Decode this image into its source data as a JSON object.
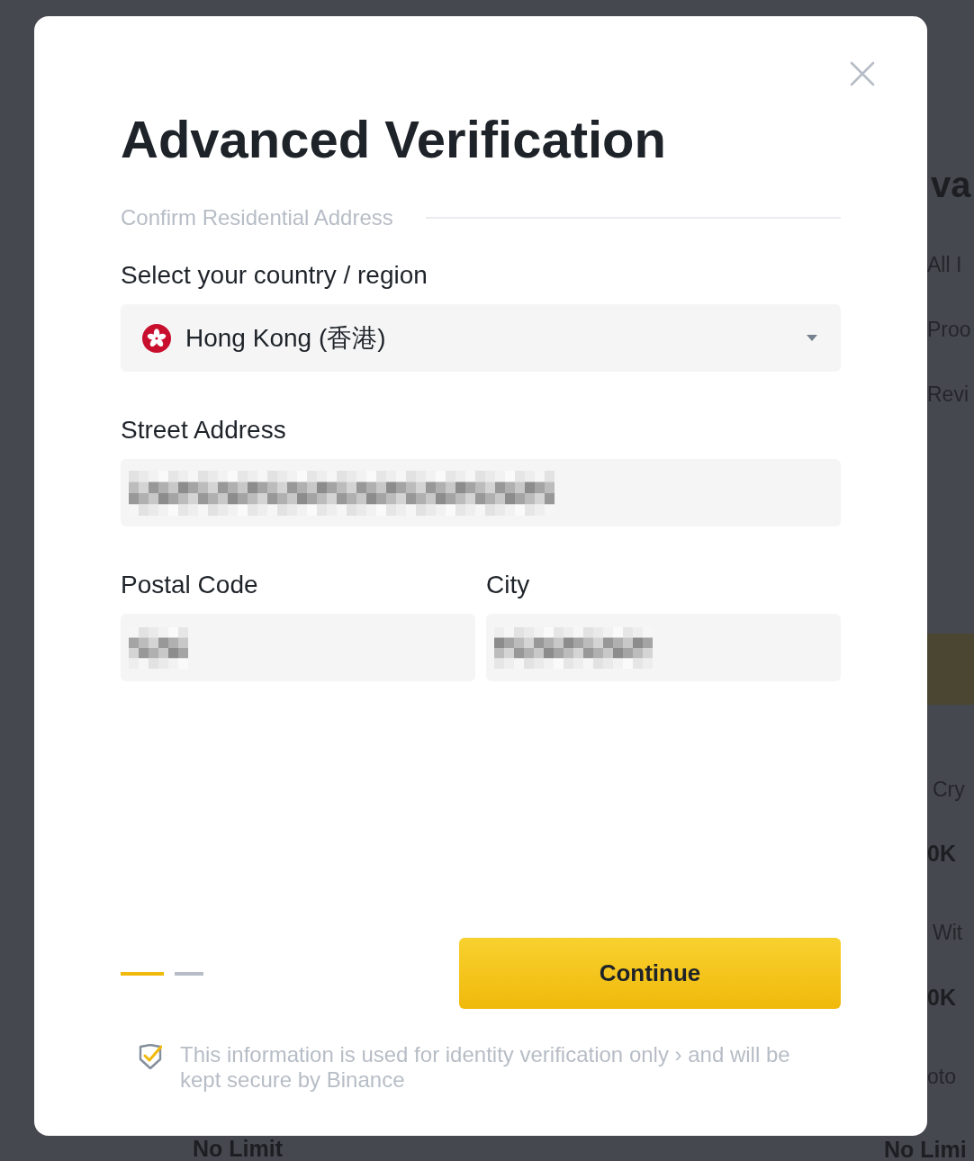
{
  "background_page": {
    "side_items": [
      {
        "kind": "title",
        "text": "va"
      },
      {
        "kind": "label",
        "text": "All I"
      },
      {
        "kind": "label",
        "text": "Proo"
      },
      {
        "kind": "label",
        "text": "Revi"
      },
      {
        "kind": "banner"
      },
      {
        "kind": "label",
        "text": "Cry"
      },
      {
        "kind": "value",
        "text": "0K"
      },
      {
        "kind": "label",
        "text": "Wit"
      },
      {
        "kind": "value",
        "text": "0K"
      },
      {
        "kind": "label",
        "text": "oto"
      }
    ],
    "bottom_items": [
      {
        "text": "No Limit"
      },
      {
        "text": "No Limi"
      }
    ]
  },
  "dialog": {
    "title": "Advanced Verification",
    "section": "Confirm Residential Address",
    "country": {
      "label": "Select your country / region",
      "value": "Hong Kong (香港)"
    },
    "fields": [
      {
        "label": "Street Address",
        "redacted": true
      },
      {
        "label": "Postal Code",
        "redacted": true
      },
      {
        "label": "City",
        "redacted": true
      }
    ],
    "steps": [
      {
        "selected": true
      },
      {
        "selected": false
      }
    ],
    "primary_button": "Continue",
    "note": "This information is used for identity verification only › and will be kept secure by Binance"
  }
}
